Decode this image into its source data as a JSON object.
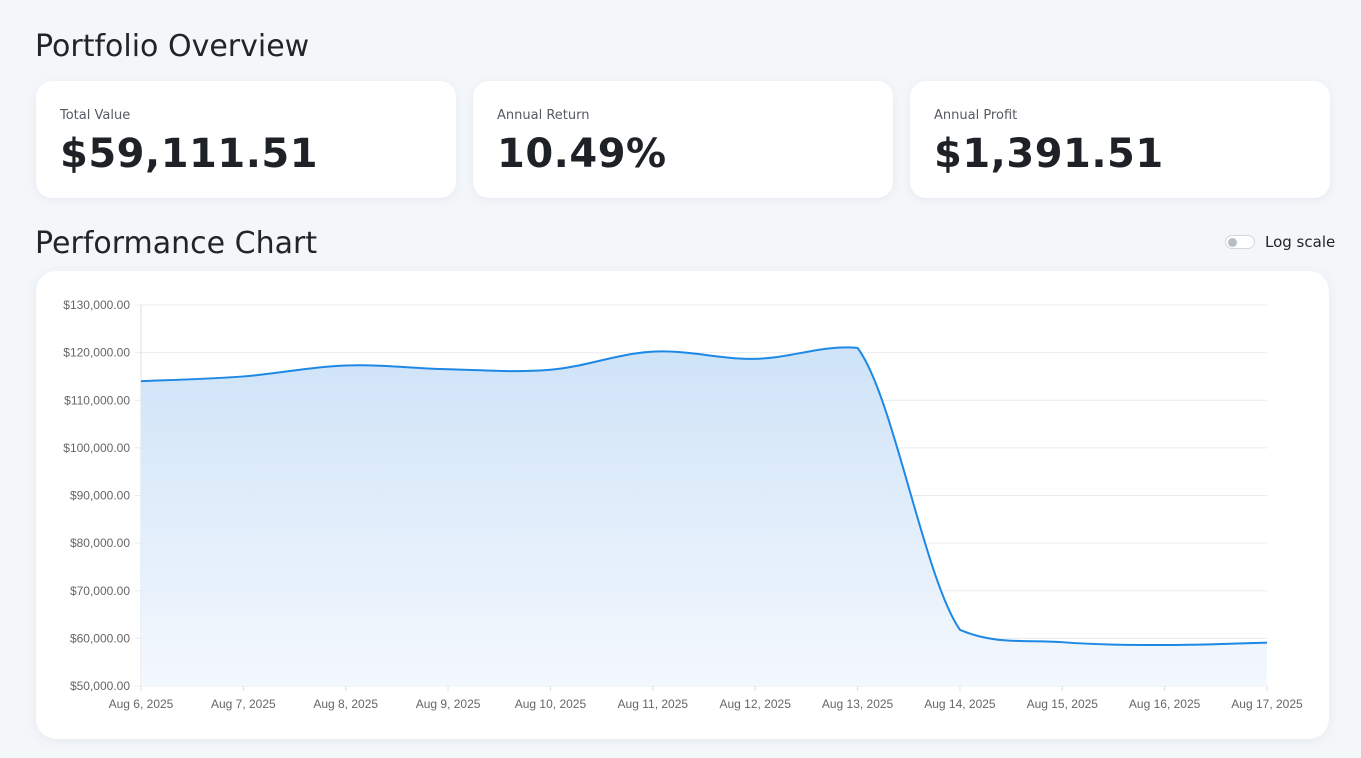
{
  "page": {
    "title": "Portfolio Overview"
  },
  "stats": [
    {
      "label": "Total Value",
      "value": "$59,111.51"
    },
    {
      "label": "Annual Return",
      "value": "10.49%"
    },
    {
      "label": "Annual Profit",
      "value": "$1,391.51"
    }
  ],
  "performance": {
    "title": "Performance Chart",
    "log_scale_label": "Log scale",
    "log_scale_enabled": false
  },
  "colors": {
    "line": "#1e88e5",
    "area_top": "#cfe3f8",
    "area_bottom": "#f3f8fd",
    "grid": "#e9ecef"
  },
  "chart_data": {
    "type": "area",
    "categories": [
      "Aug 6, 2025",
      "Aug 7, 2025",
      "Aug 8, 2025",
      "Aug 9, 2025",
      "Aug 10, 2025",
      "Aug 11, 2025",
      "Aug 12, 2025",
      "Aug 13, 2025",
      "Aug 14, 2025",
      "Aug 15, 2025",
      "Aug 16, 2025",
      "Aug 17, 2025"
    ],
    "values": [
      114000,
      115000,
      117300,
      116500,
      116400,
      120200,
      118700,
      121000,
      61800,
      59200,
      58600,
      59100
    ],
    "ylim": [
      50000,
      130000
    ],
    "yticks": [
      "$50,000.00",
      "$60,000.00",
      "$70,000.00",
      "$80,000.00",
      "$90,000.00",
      "$100,000.00",
      "$110,000.00",
      "$120,000.00",
      "$130,000.00"
    ],
    "grid": true,
    "log_scale": false
  }
}
